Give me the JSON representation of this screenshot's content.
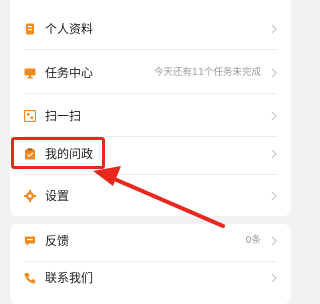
{
  "menu_top": [
    {
      "key": "profile",
      "label": "个人资料",
      "desc": ""
    },
    {
      "key": "task-center",
      "label": "任务中心",
      "desc": "今天还有11个任务未完成"
    },
    {
      "key": "scan",
      "label": "扫一扫",
      "desc": ""
    },
    {
      "key": "my-inquiry",
      "label": "我的问政",
      "desc": ""
    },
    {
      "key": "settings",
      "label": "设置",
      "desc": ""
    }
  ],
  "menu_bottom": [
    {
      "key": "feedback",
      "label": "反馈",
      "desc": "0条"
    },
    {
      "key": "contact-us",
      "label": "联系我们",
      "desc": ""
    }
  ],
  "colors": {
    "accent": "#f0891e",
    "highlight": "#e8271d",
    "background": "#f2f2f2"
  }
}
